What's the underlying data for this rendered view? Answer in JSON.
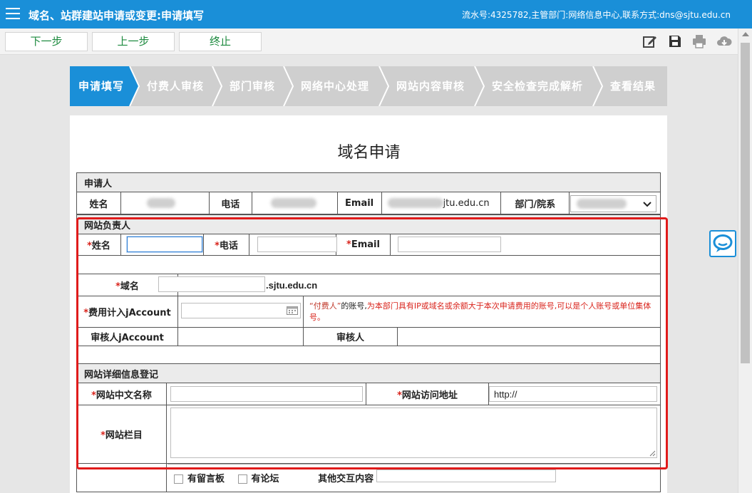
{
  "header": {
    "title": "域名、站群建站申请或变更:申请填写",
    "meta": "流水号:4325782,主管部门:网络信息中心,联系方式:dns@sjtu.edu.cn"
  },
  "toolbar": {
    "next_label": "下一步",
    "prev_label": "上一步",
    "stop_label": "终止"
  },
  "steps": [
    {
      "label": "申请填写",
      "active": true
    },
    {
      "label": "付费人审核"
    },
    {
      "label": "部门审核"
    },
    {
      "label": "网络中心处理"
    },
    {
      "label": "网站内容审核"
    },
    {
      "label": "安全检查完成解析"
    },
    {
      "label": "查看结果"
    }
  ],
  "form": {
    "title": "域名申请",
    "applicant": {
      "section": "申请人",
      "name_label": "姓名",
      "phone_label": "电话",
      "email_label": "Email",
      "email_value": "jtu.edu.cn",
      "dept_label": "部门/院系"
    },
    "owner": {
      "section": "网站负责人",
      "name_label": "姓名",
      "phone_label": "电话",
      "email_label": "Email"
    },
    "domain": {
      "label": "域名",
      "suffix": ".sjtu.edu.cn"
    },
    "billing": {
      "label": "费用计入jAccount",
      "hint_quote": "“付费人”",
      "hint_mid": "的账号,",
      "hint_rest": "为本部门具有IP或域名或余额大于本次申请费用的账号,可以是个人账号或单位集体号。"
    },
    "reviewer": {
      "account_label": "审核人jAccount",
      "name_label": "审核人"
    },
    "detail": {
      "section": "网站详细信息登记",
      "cn_name_label": "网站中文名称",
      "url_label": "网站访问地址",
      "url_value": "http://",
      "columns_label": "网站栏目",
      "guestbook_label": "有留言板",
      "forum_label": "有论坛",
      "other_label": "其他交互内容"
    },
    "required_mark": "*"
  }
}
